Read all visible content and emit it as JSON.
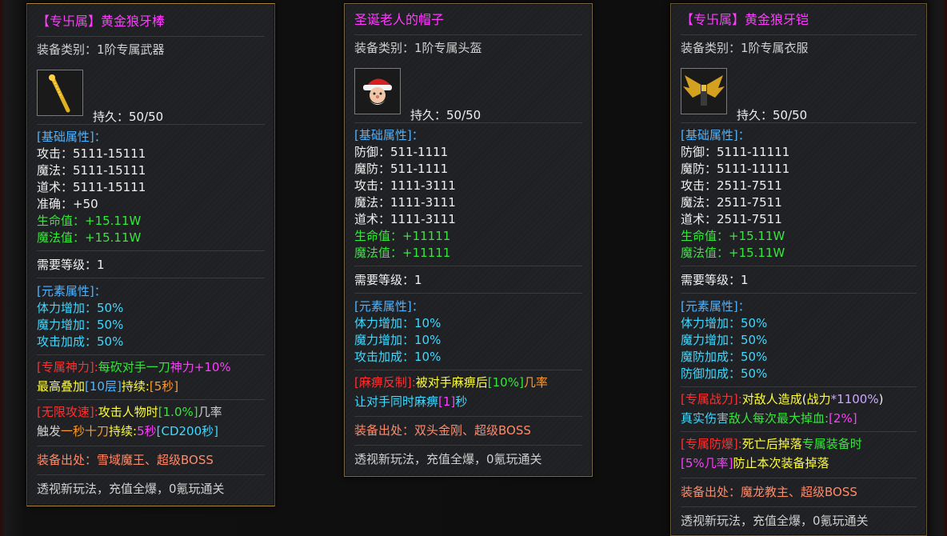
{
  "panels": [
    {
      "title": "【专卐属】黄金狼牙棒",
      "category": "装备类别：1阶专属武器",
      "icon": "golden-mace-icon",
      "durability": "持久：50/50",
      "base_header": "[基础属性]：",
      "base_stats": [
        "攻击：5111-15111",
        "魔法：5111-15111",
        "道术：5111-15111",
        "准确：+50"
      ],
      "base_green": [
        "生命值：+15.11W",
        "魔法值：+15.11W"
      ],
      "level": "需要等级：1",
      "element_header": "[元素属性]：",
      "element_stats": [
        "体力增加：50%",
        "魔力增加：50%",
        "攻击加成：50%"
      ],
      "skill1": {
        "a": "[专属神力]:",
        "b": "每砍对手一刀",
        "c": "神力+10%",
        "d": "最高叠加",
        "e": "[10层]",
        "f": "持续:",
        "g": "[5秒]"
      },
      "skill2": {
        "a": "[无限攻速]:",
        "b": "攻击人物时",
        "c": "[1.0%]",
        "d": "几率",
        "e": "触发",
        "f": "一秒十刀",
        "g": "持续:",
        "h": "5秒",
        "i": "[CD200秒]"
      },
      "source": "装备出处：雪域魔王、超级BOSS",
      "footer": "透视新玩法，充值全爆，0氪玩通关"
    },
    {
      "title": "圣诞老人的帽子",
      "category": "装备类别：1阶专属头盔",
      "icon": "santa-hat-icon",
      "durability": "持久：50/50",
      "base_header": "[基础属性]：",
      "base_stats": [
        "防御：511-1111",
        "魔防：511-1111",
        "攻击：1111-3111",
        "魔法：1111-3111",
        "道术：1111-3111"
      ],
      "base_green": [
        "生命值：+11111",
        "魔法值：+11111"
      ],
      "level": "需要等级：1",
      "element_header": "[元素属性]：",
      "element_stats": [
        "体力增加：10%",
        "魔力增加：10%",
        "攻击加成：10%"
      ],
      "skill1": {
        "a": "[麻痹反制]:",
        "b": "被对手麻痹后",
        "c": "[10%]",
        "d": "几率",
        "e": "让对手同时麻痹",
        "f": "[1]",
        "g": "秒"
      },
      "source": "装备出处：双头金刚、超级BOSS",
      "footer": "透视新玩法，充值全爆，0氪玩通关"
    },
    {
      "title": "【专卐属】黄金狼牙铠",
      "category": "装备类别：1阶专属衣服",
      "icon": "golden-wing-armor-icon",
      "durability": "持久：50/50",
      "base_header": "[基础属性]：",
      "base_stats": [
        "防御：5111-11111",
        "魔防：5111-11111",
        "攻击：2511-7511",
        "魔法：2511-7511",
        "道术：2511-7511"
      ],
      "base_green": [
        "生命值：+15.11W",
        "魔法值：+15.11W"
      ],
      "level": "需要等级：1",
      "element_header": "[元素属性]：",
      "element_stats": [
        "体力增加：50%",
        "魔力增加：50%",
        "魔防加成：50%",
        "防御加成：50%"
      ],
      "skill1": {
        "a": "[专属战力]:",
        "b": "对敌人造成",
        "c": "(",
        "d": "战力",
        "e": "*1100%",
        "f": ")",
        "g": "真实伤害",
        "h": "敌人每次最大掉血:",
        "i": "[2%]"
      },
      "skill2": {
        "a": "[专属防爆]:",
        "b": "死亡后掉落",
        "c": "专属装备时",
        "d": "[5%几率]",
        "e": "防止本次装备掉落"
      },
      "source": "装备出处：魔龙教主、超级BOSS",
      "footer": "透视新玩法，充值全爆，0氪玩通关"
    }
  ],
  "colors": {
    "magenta": "#ff3cff",
    "blue_header": "#4fb4ff",
    "cyan": "#3fd8ff",
    "green": "#37e63c",
    "red": "#ff3030",
    "yellow": "#ffff3c",
    "orange": "#ff9a2c",
    "salmon": "#ff8a6a"
  }
}
